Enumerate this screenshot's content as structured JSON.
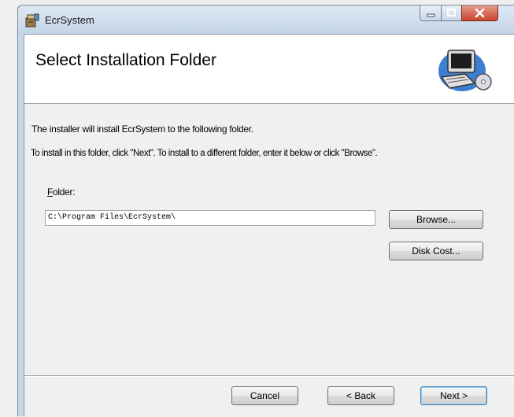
{
  "window": {
    "title": "EcrSystem"
  },
  "header": {
    "title": "Select Installation Folder"
  },
  "body": {
    "intro": "The installer will install EcrSystem to the following folder.",
    "instructions": "To install in this folder, click \"Next\". To install to a different folder, enter it below or click \"Browse\".",
    "folder_label_accel": "F",
    "folder_label_rest": "older:",
    "folder_value": "C:\\Program Files\\EcrSystem\\"
  },
  "buttons": {
    "browse": "Browse...",
    "disk_cost": "Disk Cost...",
    "cancel": "Cancel",
    "back": "< Back",
    "next": "Next >"
  },
  "icons": {
    "app": "installer-app-icon",
    "banner": "computer-cd-icon",
    "minimize": "minimize-icon",
    "maximize": "maximize-icon",
    "close": "close-icon"
  }
}
